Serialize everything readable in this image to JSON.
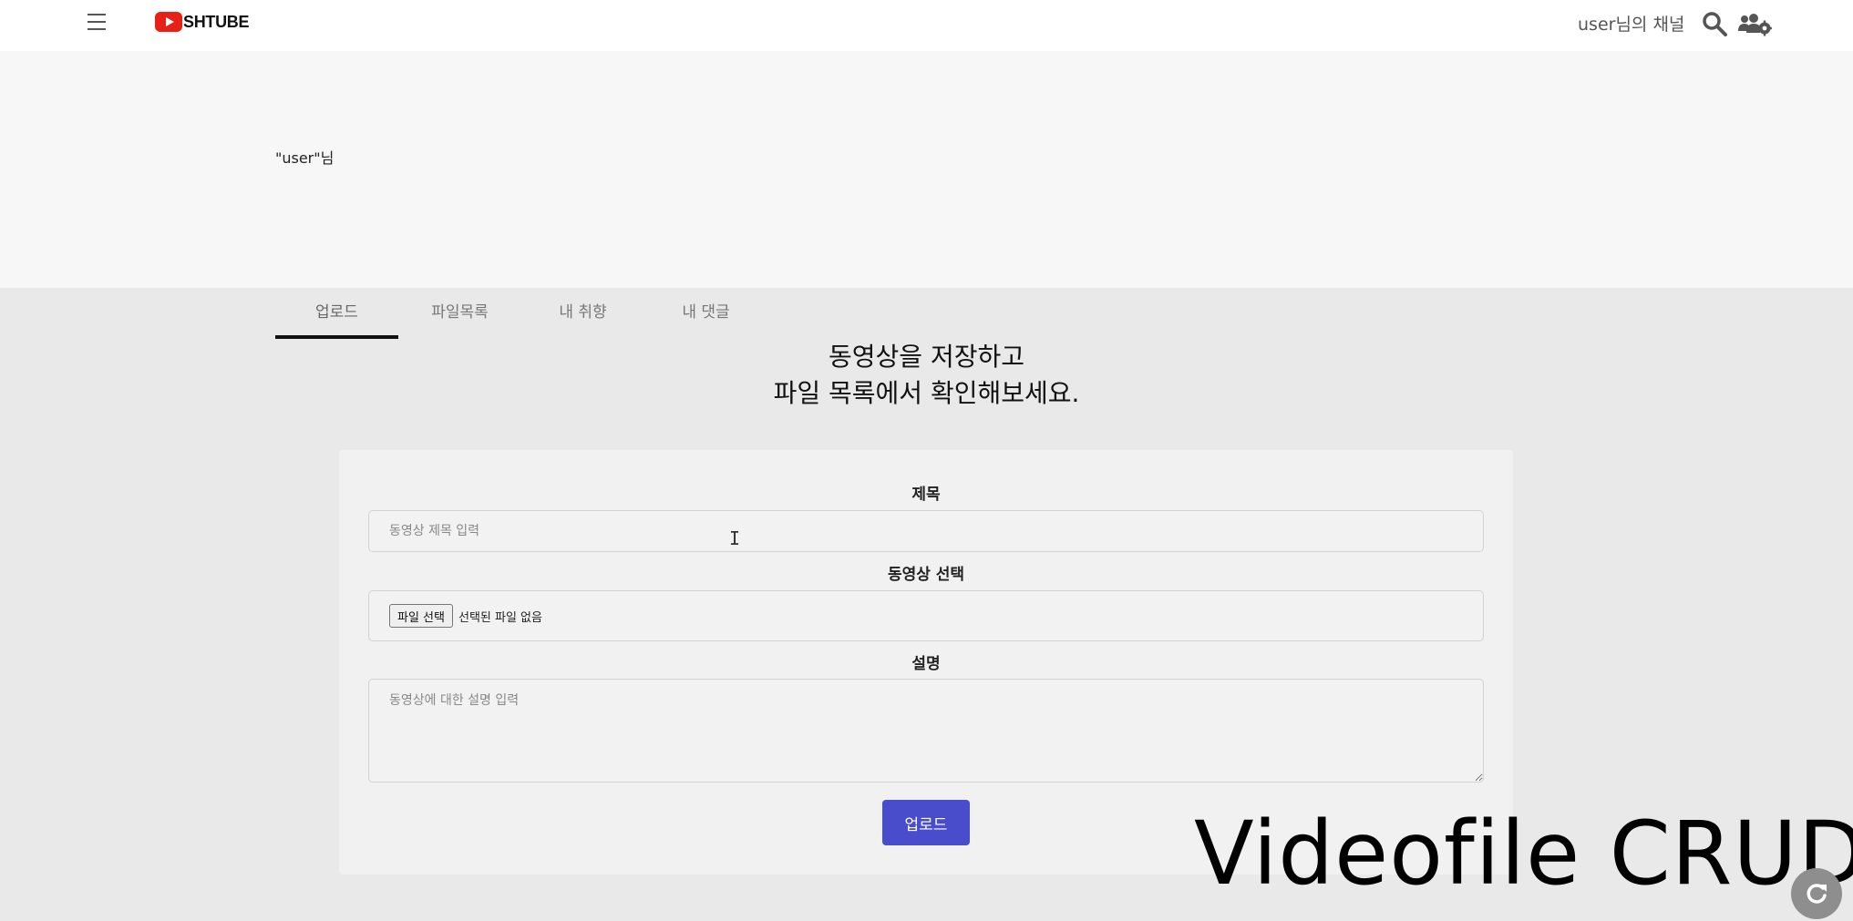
{
  "topbar": {
    "logo_text": "SHTUBE",
    "channel_link": "user님의 채널",
    "icons": {
      "menu": "hamburger-menu-icon",
      "logo": "play-button-icon",
      "search": "search-icon",
      "users": "users-settings-icon"
    },
    "brand_color": "#e62117"
  },
  "channel": {
    "name": "\"user\"님"
  },
  "tabs": [
    {
      "label": "업로드",
      "active": true
    },
    {
      "label": "파일목록",
      "active": false
    },
    {
      "label": "내 취향",
      "active": false
    },
    {
      "label": "내 댓글",
      "active": false
    }
  ],
  "main": {
    "headline_line1": "동영상을 저장하고",
    "headline_line2": "파일 목록에서 확인해보세요."
  },
  "form": {
    "title_label": "제목",
    "title_placeholder": "동영상 제목 입력",
    "title_value": "",
    "video_label": "동영상 선택",
    "file_button_label": "파일 선택",
    "file_status": "선택된 파일 없음",
    "description_label": "설명",
    "description_placeholder": "동영상에 대한 설명 입력",
    "description_value": "",
    "submit_label": "업로드",
    "accent_color": "#4a4dcb"
  },
  "overlay": {
    "caption": "Videofile CRUD",
    "refresh_icon": "refresh-icon"
  }
}
